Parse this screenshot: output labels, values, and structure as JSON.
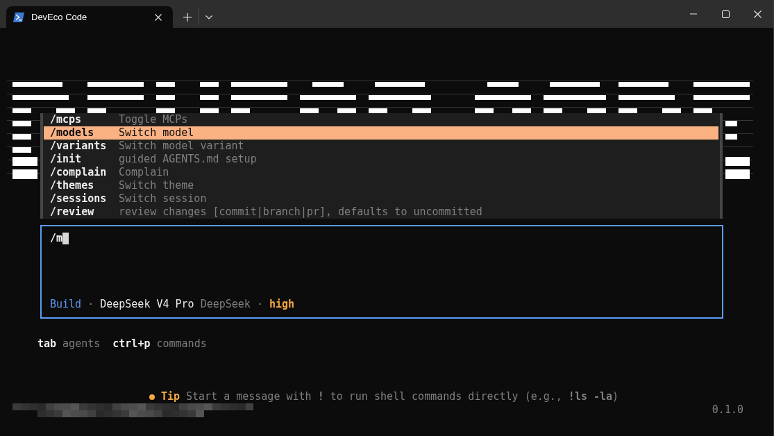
{
  "window": {
    "tab": {
      "title": "DevEco Code",
      "selected": true
    }
  },
  "command_menu": {
    "items": [
      {
        "command": "/mcps",
        "description": "Toggle MCPs",
        "selected": false
      },
      {
        "command": "/models",
        "description": "Switch model",
        "selected": true
      },
      {
        "command": "/variants",
        "description": "Switch model variant",
        "selected": false
      },
      {
        "command": "/init",
        "description": "guided AGENTS.md setup",
        "selected": false
      },
      {
        "command": "/complain",
        "description": "Complain",
        "selected": false
      },
      {
        "command": "/themes",
        "description": "Switch theme",
        "selected": false
      },
      {
        "command": "/sessions",
        "description": "Switch session",
        "selected": false
      },
      {
        "command": "/review",
        "description": "review changes [commit|branch|pr], defaults to uncommitted",
        "selected": false
      }
    ]
  },
  "prompt": {
    "value": "/m",
    "status": [
      {
        "kind": "agent",
        "text": "Build"
      },
      {
        "kind": "separator",
        "text": "·"
      },
      {
        "kind": "model",
        "text": "DeepSeek V4 Pro"
      },
      {
        "kind": "provider",
        "text": "DeepSeek"
      },
      {
        "kind": "separator",
        "text": "·"
      },
      {
        "kind": "variant",
        "text": "high"
      }
    ]
  },
  "hints": [
    {
      "key": "tab",
      "label": "agents"
    },
    {
      "key": "ctrl+p",
      "label": "commands"
    }
  ],
  "tip": {
    "label": "Tip",
    "text": "Start a message with **!** to run shell commands directly (e.g., **!ls -la**)"
  },
  "version": "0.1.0"
}
